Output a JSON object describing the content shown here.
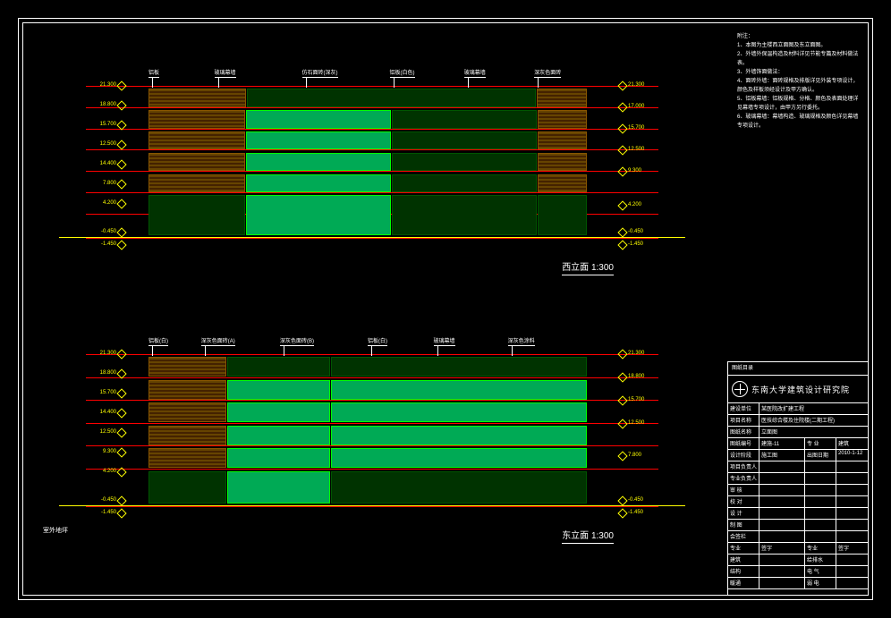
{
  "notes": {
    "heading": "附注：",
    "lines": [
      "1、本图为主楼西立面图及东立面图。",
      "2、外墙外保温构造及材料详见节能专篇及材料做法表。",
      "3、外墙饰面做法：",
      "4、面砖外墙：面砖规格及排版详见外装专项设计，颜色及样板须经设计及甲方确认。",
      "5、铝板幕墙：铝板规格、分格、颜色及表面处理详见幕墙专项设计，由甲方另行委托。",
      "6、玻璃幕墙：幕墙构造、玻璃规格及颜色详见幕墙专项设计。"
    ]
  },
  "elevations": [
    {
      "title": "西立面   1:300",
      "levels_left": [
        "21.300",
        "18.800",
        "15.700",
        "12.500",
        "14.400",
        "7.800",
        "4.200",
        "-0.450",
        "-1.450"
      ],
      "levels_right": [
        "21.300",
        "17.000",
        "15.700",
        "12.500",
        "9.300",
        "4.200",
        "-0.450",
        "-1.450"
      ],
      "callouts": [
        "铝板",
        "玻璃幕墙",
        "仿石面砖(深灰)",
        "铝板(白色)",
        "玻璃幕墙",
        "深灰色面砖"
      ]
    },
    {
      "title": "东立面   1:300",
      "levels_left": [
        "21.300",
        "18.800",
        "15.700",
        "14.400",
        "12.500",
        "9.300",
        "4.200",
        "-0.450",
        "-1.450"
      ],
      "levels_right": [
        "21.300",
        "18.800",
        "15.700",
        "12.500",
        "7.800",
        "-0.450",
        "-1.450"
      ],
      "callouts": [
        "铝板(白)",
        "深灰色面砖(A)",
        "深灰色面砖(B)",
        "铝板(白)",
        "玻璃幕墙",
        "深灰色涂料"
      ]
    }
  ],
  "corner_label": "室外地坪",
  "title_block": {
    "header": "图纸目录",
    "institute": "东南大学建筑设计研究院",
    "rows": [
      {
        "k": "建设单位",
        "v": "某医院改扩建工程"
      },
      {
        "k": "项目名称",
        "v": "医技综合楼及住院楼(二期工程)"
      },
      {
        "k": "图纸名称",
        "v": "立面图"
      },
      {
        "k": "图纸编号",
        "v": "建施-11",
        "k2": "专 业",
        "v2": "建筑"
      },
      {
        "k": "设计阶段",
        "v": "施工图",
        "k2": "出图日期",
        "v2": "2010-1-12"
      },
      {
        "k": "项目负责人",
        "v": "",
        "k2": "",
        "v2": ""
      },
      {
        "k": "专业负责人",
        "v": "",
        "k2": "",
        "v2": ""
      },
      {
        "k": "审 核",
        "v": "",
        "k2": "",
        "v2": ""
      },
      {
        "k": "校 对",
        "v": "",
        "k2": "",
        "v2": ""
      },
      {
        "k": "设 计",
        "v": "",
        "k2": "",
        "v2": ""
      },
      {
        "k": "制 图",
        "v": "",
        "k2": "",
        "v2": ""
      },
      {
        "k": "会签栏",
        "v": "",
        "k2": "",
        "v2": ""
      }
    ],
    "signoff": [
      {
        "k": "专业",
        "v": "签字",
        "k2": "专业",
        "v2": "签字"
      },
      {
        "k": "建筑",
        "v": "",
        "k2": "给排水",
        "v2": ""
      },
      {
        "k": "结构",
        "v": "",
        "k2": "电 气",
        "v2": ""
      },
      {
        "k": "暖通",
        "v": "",
        "k2": "弱 电",
        "v2": ""
      }
    ]
  }
}
